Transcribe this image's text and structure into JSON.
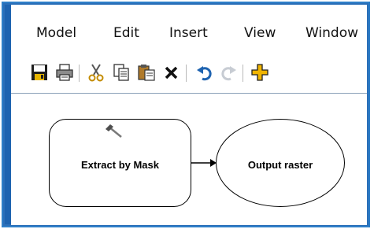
{
  "menubar": {
    "items": [
      "Model",
      "Edit",
      "Insert",
      "View",
      "Window"
    ]
  },
  "toolbar": {
    "buttons": [
      {
        "icon": "save-icon"
      },
      {
        "icon": "print-icon"
      },
      {
        "icon": "cut-icon"
      },
      {
        "icon": "copy-icon"
      },
      {
        "icon": "paste-icon"
      },
      {
        "icon": "delete-icon"
      },
      {
        "icon": "undo-icon"
      },
      {
        "icon": "redo-icon"
      },
      {
        "icon": "add-data-icon"
      }
    ]
  },
  "model": {
    "process_label": "Extract by Mask",
    "output_label": "Output raster"
  },
  "colors": {
    "frame_blue": "#2b6fb8",
    "accent_blue": "#1e63b0"
  }
}
